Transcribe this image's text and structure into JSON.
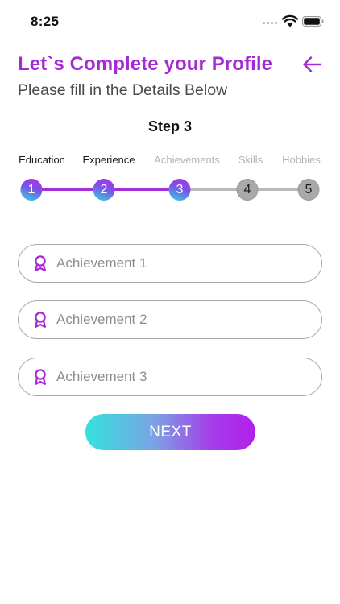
{
  "status_bar": {
    "time": "8:25"
  },
  "header": {
    "title": "Let`s Complete your Profile",
    "subtitle": "Please fill in the Details Below",
    "back_icon": "arrow-left-icon"
  },
  "step_title": "Step 3",
  "stepper": {
    "current_step": 3,
    "steps": [
      {
        "label": "Education",
        "number": "1",
        "state": "done"
      },
      {
        "label": "Experience",
        "number": "2",
        "state": "done"
      },
      {
        "label": "Achievements",
        "number": "3",
        "state": "current"
      },
      {
        "label": "Skills",
        "number": "4",
        "state": "todo"
      },
      {
        "label": "Hobbies",
        "number": "5",
        "state": "todo"
      }
    ]
  },
  "fields": [
    {
      "placeholder": "Achievement 1",
      "value": "",
      "icon": "award-ribbon-icon"
    },
    {
      "placeholder": "Achievement 2",
      "value": "",
      "icon": "award-ribbon-icon"
    },
    {
      "placeholder": "Achievement 3",
      "value": "",
      "icon": "award-ribbon-icon"
    }
  ],
  "next_button": {
    "label": "NEXT"
  },
  "colors": {
    "accent": "#A62AD3",
    "gradient_start": "#33E2DE",
    "gradient_end": "#B021EA",
    "inactive_step": "#A9A9A9"
  }
}
